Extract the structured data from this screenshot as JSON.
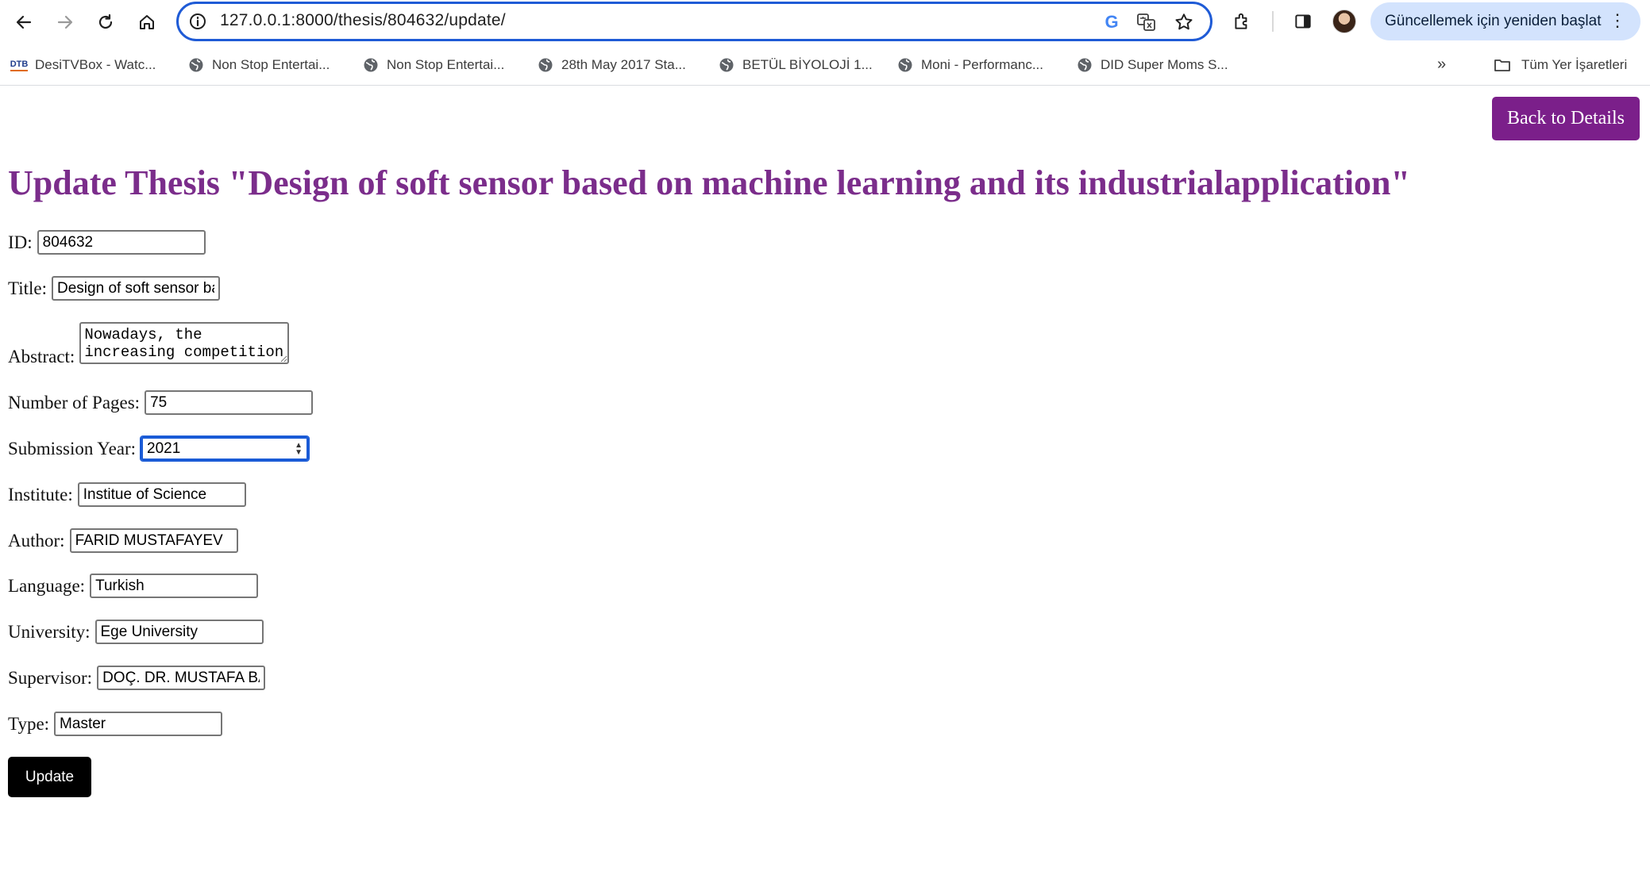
{
  "browser": {
    "url": "127.0.0.1:8000/thesis/804632/update/",
    "restart_label": "Güncellemek için yeniden başlat",
    "bookmarks": [
      {
        "label": "DesiTVBox - Watc...",
        "icon": "dtb-favicon"
      },
      {
        "label": "Non Stop Entertai...",
        "icon": "globe-icon"
      },
      {
        "label": "Non Stop Entertai...",
        "icon": "globe-icon"
      },
      {
        "label": "28th May 2017 Sta...",
        "icon": "globe-icon"
      },
      {
        "label": "BETÜL BİYOLOJİ 1...",
        "icon": "globe-icon"
      },
      {
        "label": "Moni - Performanc...",
        "icon": "globe-icon"
      },
      {
        "label": "DID Super Moms S...",
        "icon": "globe-icon"
      }
    ],
    "all_bookmarks_label": "Tüm Yer İşaretleri",
    "dtb_favicon_text": "DTB"
  },
  "page": {
    "back_button": "Back to Details",
    "heading": "Update Thesis \"Design of soft sensor based on machine learning and its industrialapplication\"",
    "fields": {
      "id": {
        "label": "ID:",
        "value": "804632"
      },
      "title": {
        "label": "Title:",
        "value": "Design of soft sensor based on machine learning and its industrialapplication"
      },
      "abstract": {
        "label": "Abstract:",
        "value": "Nowadays, the increasing competition"
      },
      "pages": {
        "label": "Number of Pages:",
        "value": "75"
      },
      "year": {
        "label": "Submission Year:",
        "value": "2021"
      },
      "institute": {
        "label": "Institute:",
        "value": "Institue of Science"
      },
      "author": {
        "label": "Author:",
        "value": "FARID MUSTAFAYEV"
      },
      "language": {
        "label": "Language:",
        "value": "Turkish"
      },
      "university": {
        "label": "University:",
        "value": "Ege University"
      },
      "supervisor": {
        "label": "Supervisor:",
        "value": "DOÇ. DR. MUSTAFA BAYRAM"
      },
      "type": {
        "label": "Type:",
        "value": "Master"
      }
    },
    "submit_label": "Update"
  },
  "colors": {
    "accent": "#7b1f8a",
    "heading": "#7b2d8b",
    "omnibox_border": "#1f5bd6",
    "restart_bg": "#d3e3fd"
  }
}
